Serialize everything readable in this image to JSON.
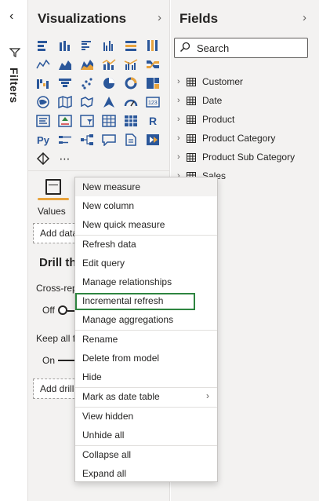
{
  "filters": {
    "label": "Filters",
    "collapse_icon": "chevron-left-icon"
  },
  "visualizations": {
    "title": "Visualizations",
    "values_label": "Values",
    "add_data_label": "Add data fields here",
    "drill_title": "Drill through",
    "cross_report_label": "Cross-report",
    "cross_report_value": "Off",
    "keep_filters_label": "Keep all filters",
    "keep_filters_value": "On",
    "add_drill_label": "Add drill-through fields here",
    "icons": [
      "stacked-bar-icon",
      "stacked-column-icon",
      "clustered-bar-icon",
      "clustered-column-icon",
      "100-bar-icon",
      "100-column-icon",
      "line-chart-icon",
      "area-chart-icon",
      "stacked-area-icon",
      "line-column-icon",
      "line-clustered-icon",
      "ribbon-icon",
      "waterfall-icon",
      "funnel-icon",
      "scatter-icon",
      "pie-icon",
      "donut-icon",
      "treemap-icon",
      "map-icon",
      "filled-map-icon",
      "shape-map-icon",
      "azure-map-icon",
      "gauge-icon",
      "card-icon",
      "multirow-card-icon",
      "kpi-icon",
      "slicer-icon",
      "table-icon",
      "matrix-icon",
      "r-visual-icon",
      "python-visual-icon",
      "key-influencers-icon",
      "decomposition-tree-icon",
      "qa-icon",
      "paginated-report-icon",
      "power-automate-icon",
      "smart-narrative-icon",
      "more-icon"
    ]
  },
  "fields": {
    "title": "Fields",
    "search_placeholder": "Search",
    "items": [
      "Customer",
      "Date",
      "Product",
      "Product Category",
      "Product Sub Category",
      "Sales"
    ]
  },
  "context_menu": {
    "items": [
      "New measure",
      "New column",
      "New quick measure",
      "Refresh data",
      "Edit query",
      "Manage relationships",
      "Incremental refresh",
      "Manage aggregations",
      "Rename",
      "Delete from model",
      "Hide",
      "Mark as date table",
      "View hidden",
      "Unhide all",
      "Collapse all",
      "Expand all"
    ]
  },
  "colors": {
    "highlight": "#2e8540",
    "accent": "#e8a33d",
    "pane_bg": "#f3f2f1"
  }
}
